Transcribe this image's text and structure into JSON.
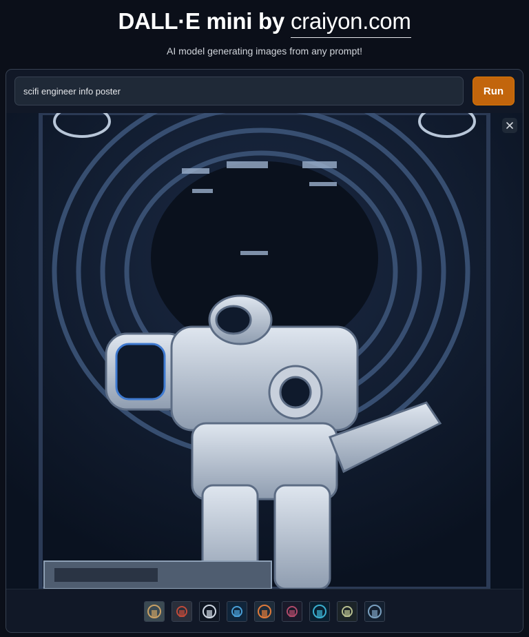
{
  "header": {
    "title_prefix": "DALL·E mini by",
    "brand_link": "craiyon.com",
    "subtitle": "AI model generating images from any prompt!"
  },
  "prompt": {
    "value": "scifi engineer info poster",
    "placeholder": ""
  },
  "run_button": {
    "label": "Run"
  },
  "preview": {
    "close_icon": "close-icon"
  },
  "thumbnails": [
    {
      "name": "thumbnail-1",
      "palette": [
        "#3b4a52",
        "#c9a064"
      ]
    },
    {
      "name": "thumbnail-2",
      "palette": [
        "#2a2f3b",
        "#c04a3a"
      ]
    },
    {
      "name": "thumbnail-3",
      "palette": [
        "#0f1622",
        "#cfd8e3"
      ]
    },
    {
      "name": "thumbnail-4",
      "palette": [
        "#10253a",
        "#4aa0d8"
      ]
    },
    {
      "name": "thumbnail-5",
      "palette": [
        "#1e2c3a",
        "#e07a3a"
      ]
    },
    {
      "name": "thumbnail-6",
      "palette": [
        "#1a1a2a",
        "#b04a6a"
      ]
    },
    {
      "name": "thumbnail-7",
      "palette": [
        "#0a2030",
        "#3ab0d0"
      ]
    },
    {
      "name": "thumbnail-8",
      "palette": [
        "#1c2428",
        "#b8c090"
      ]
    },
    {
      "name": "thumbnail-9",
      "palette": [
        "#142030",
        "#7aa0c0"
      ]
    }
  ],
  "colors": {
    "background": "#0b0f19",
    "panel": "#111827",
    "run_button": "#c2650c"
  }
}
